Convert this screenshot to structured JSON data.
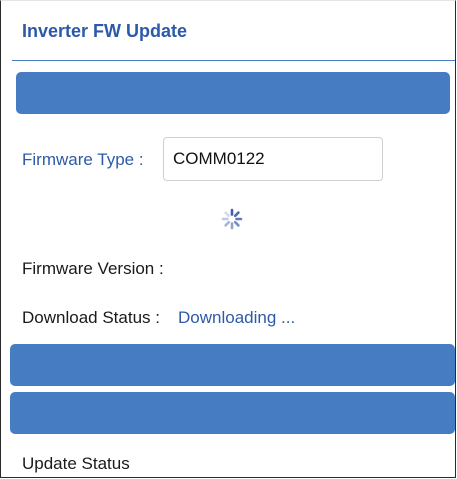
{
  "header": {
    "title": "Inverter FW Update"
  },
  "firmware": {
    "type_label": "Firmware Type :",
    "type_value": "COMM0122",
    "version_label": "Firmware Version :"
  },
  "download": {
    "status_label": "Download Status :",
    "status_value": "Downloading ..."
  },
  "update": {
    "status_label": "Update Status"
  },
  "colors": {
    "accent": "#2d5aa8",
    "button": "#467dc2"
  },
  "icons": {
    "loading": "loading-spinner-icon"
  }
}
